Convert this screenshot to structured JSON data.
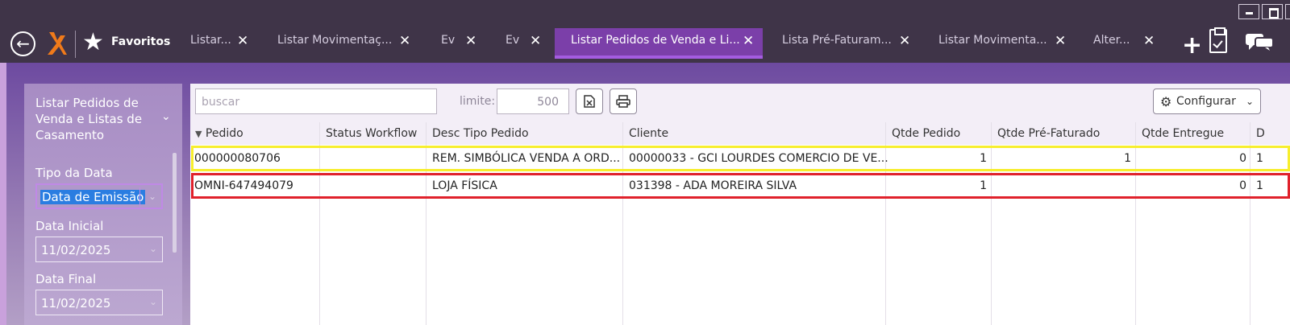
{
  "tabbar": {
    "favorites_label": "Favoritos",
    "tabs": [
      {
        "label": "Listar...",
        "active": false
      },
      {
        "label": "Listar Movimentaç...",
        "active": false
      },
      {
        "label": "Ev",
        "active": false
      },
      {
        "label": "Ev",
        "active": false
      },
      {
        "label": "Listar Pedidos de Venda e Li...",
        "active": true
      },
      {
        "label": "Lista Pré-Faturam...",
        "active": false
      },
      {
        "label": "Listar Movimenta...",
        "active": false
      },
      {
        "label": "Alter...",
        "active": false
      }
    ]
  },
  "sidebar": {
    "title": "Listar Pedidos de Venda e Listas de Casamento",
    "tipo_data_label": "Tipo da Data",
    "tipo_data_value": "Data de Emissão",
    "data_inicial_label": "Data Inicial",
    "data_inicial_value": "11/02/2025",
    "data_final_label": "Data Final",
    "data_final_value": "11/02/2025"
  },
  "toolbar": {
    "search_placeholder": "buscar",
    "limit_label": "limite:",
    "limit_value": "500",
    "configure_label": "Configurar"
  },
  "table": {
    "columns": [
      "Pedido",
      "Status Workflow",
      "Desc Tipo Pedido",
      "Cliente",
      "Qtde Pedido",
      "Qtde Pré-Faturado",
      "Qtde Entregue",
      "D"
    ],
    "rows": [
      {
        "pedido": "000000080706",
        "status": "",
        "desc": "REM. SIMBÓLICA VENDA A ORD...",
        "cliente": "00000033 - GCI LOURDES COMERCIO DE VE...",
        "qtde_pedido": "1",
        "qtde_pre": "1",
        "qtde_entregue": "0",
        "d": "1"
      },
      {
        "pedido": "OMNI-647494079",
        "status": "",
        "desc": "LOJA FÍSICA",
        "cliente": "031398 - ADA MOREIRA SILVA",
        "qtde_pedido": "1",
        "qtde_pre": "",
        "qtde_entregue": "0",
        "d": "1"
      }
    ]
  },
  "colors": {
    "accent": "#7b3fa9",
    "highlight_yellow": "#f7ee2d",
    "highlight_red": "#e0212b"
  }
}
